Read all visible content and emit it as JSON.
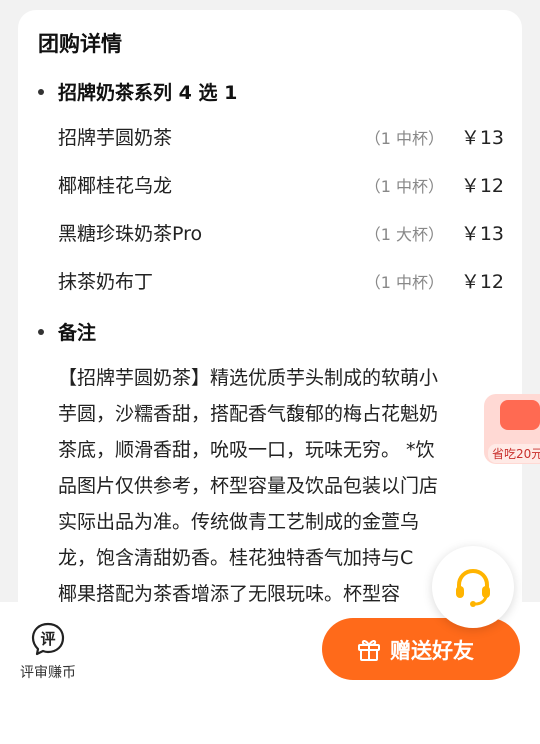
{
  "card": {
    "title": "团购详情"
  },
  "set_section": {
    "heading": "招牌奶茶系列 4 选 1",
    "items": [
      {
        "name": "招牌芋圆奶茶",
        "qty": "（1 中杯）",
        "price": "￥13"
      },
      {
        "name": "椰椰桂花乌龙",
        "qty": "（1 中杯）",
        "price": "￥12"
      },
      {
        "name": "黑糖珍珠奶茶Pro",
        "qty": "（1 大杯）",
        "price": "￥13"
      },
      {
        "name": "抹茶奶布丁",
        "qty": "（1 中杯）",
        "price": "￥12"
      }
    ]
  },
  "note_section": {
    "heading": "备注",
    "lines": [
      "【招牌芋圆奶茶】精选优质芋头制成的软萌小",
      "芋圆，沙糯香甜，搭配香气馥郁的梅占花魁奶",
      "茶底，顺滑香甜，吮吸一口，玩味无穷。 *饮",
      "品图片仅供参考，杯型容量及饮品包装以门店",
      "实际出品为准。传统做青工艺制成的金萱乌",
      "龙，饱含清甜奶香。桂花独特香气加持与C",
      "椰果搭配为茶香增添了无限玩味。杯型容"
    ]
  },
  "promo": {
    "text": "省吃20元"
  },
  "bottom_bar": {
    "review": {
      "icon_text": "评",
      "label": "评审赚币"
    },
    "gift_button": {
      "label": "赠送好友"
    }
  },
  "colors": {
    "accent_orange": "#ff6a1a",
    "badge_pink": "#ffd9d4",
    "support_yellow": "#ffb400"
  }
}
